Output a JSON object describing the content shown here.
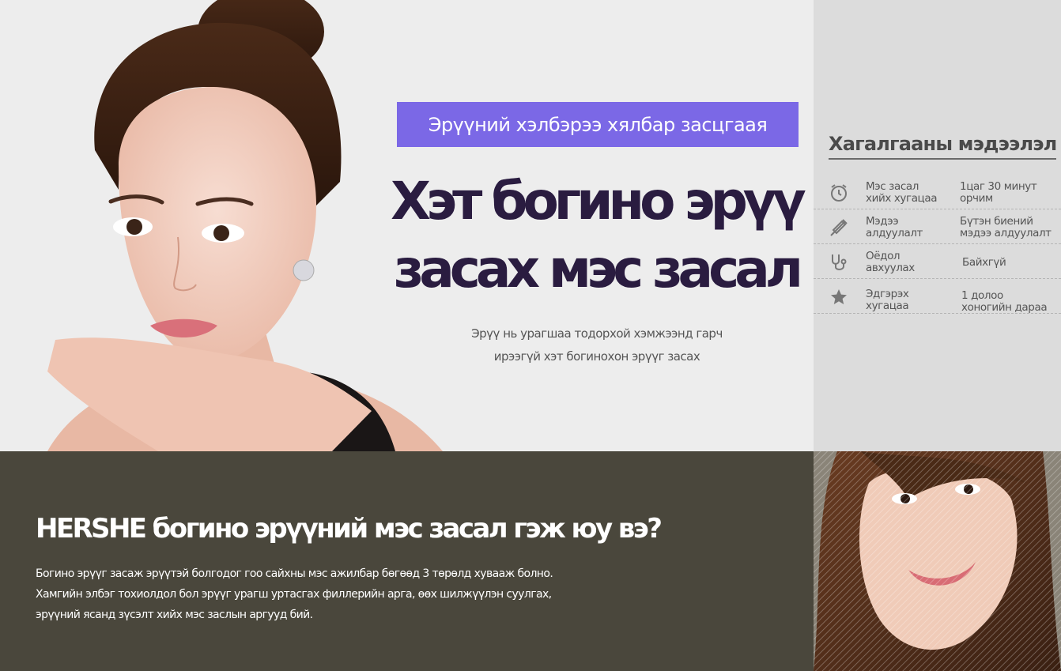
{
  "hero": {
    "banner": "Эрүүний хэлбэрээ хялбар засцгаая",
    "title_line1": "Хэт богино эрүү",
    "title_line2": "засах мэс засал",
    "subtitle_line1": "Эрүү нь урагшаа тодорхой хэмжээнд гарч",
    "subtitle_line2": "ирээгүй хэт богинохон эрүүг засах"
  },
  "side_panel": {
    "title": "Хагалгааны мэдээлэл",
    "rows": [
      {
        "icon": "alarm-clock-icon",
        "label_line1": "Мэс засал",
        "label_line2": "хийх хугацаа",
        "value_line1": "1цаг 30 минут",
        "value_line2": "орчим"
      },
      {
        "icon": "syringe-icon",
        "label_line1": "Мэдээ",
        "label_line2": "алдуулалт",
        "value_line1": "Бүтэн биений",
        "value_line2": "мэдээ алдуулалт"
      },
      {
        "icon": "stethoscope-icon",
        "label_line1": "Оёдол",
        "label_line2": "авхуулах",
        "value_line1": "Байхгүй",
        "value_line2": ""
      },
      {
        "icon": "star-icon",
        "label_line1": "Эдгэрэх",
        "label_line2": "хугацаа",
        "value_line1": "1 долоо",
        "value_line2": "хоногийн дараа"
      }
    ]
  },
  "bottom": {
    "title": "HERSHE богино эрүүний мэс засал гэж юу вэ?",
    "text_line1": "Богино эрүүг засаж эрүүтэй болгодог гоо сайхны мэс ажилбар бөгөөд 3 төрөлд хуваaж болно.",
    "text_line2": "Хамгийн элбэг тохиолдол бол эрүүг урагш уртасгах филлерийн арга, өөх шилжүүлэн суулгах,",
    "text_line3": "эрүүний ясанд зүсэлт хийх мэс заслын аргууд бий."
  },
  "colors": {
    "banner_bg": "#7b68e6",
    "title_color": "#2a1c40",
    "bottom_bg": "#4a473c",
    "side_bg": "#dcdcdc"
  }
}
